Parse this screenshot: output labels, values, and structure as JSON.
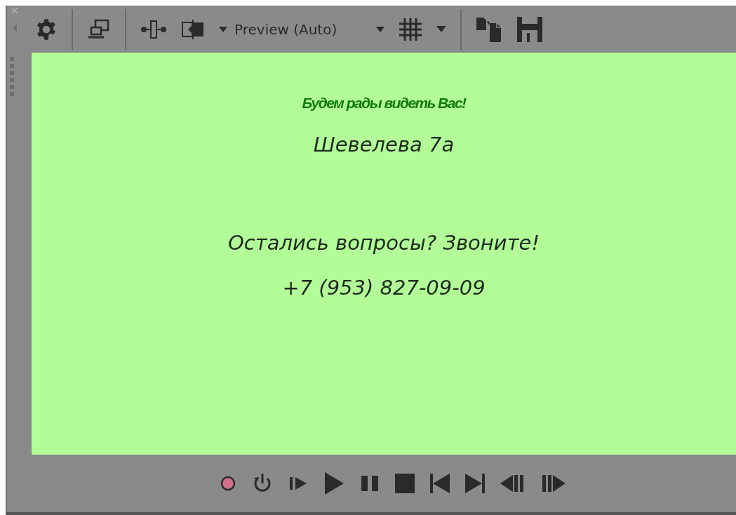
{
  "toolbar": {
    "preview_quality": "Preview (Auto)"
  },
  "preview": {
    "lines": [
      {
        "kind": "title",
        "text": "Будем рады видеть Вас!"
      },
      {
        "kind": "body",
        "text": "Шевелева 7а"
      },
      {
        "kind": "gap"
      },
      {
        "kind": "body",
        "text": "Остались вопросы? Звоните!"
      },
      {
        "kind": "body",
        "text": "+7 (953) 827-09-09"
      }
    ]
  }
}
